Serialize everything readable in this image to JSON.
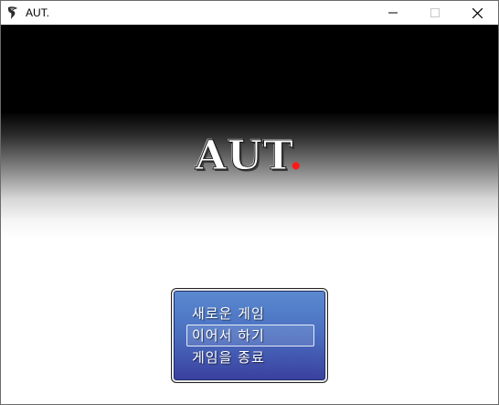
{
  "window": {
    "title": "AUT.",
    "controls": {
      "minimize_icon": "minimize-icon",
      "maximize_icon": "maximize-icon",
      "close_icon": "close-icon"
    }
  },
  "game": {
    "title_main": "AUT",
    "title_dot": ".",
    "accent_color": "#ff1a1a"
  },
  "menu": {
    "items": [
      {
        "label": "새로운 게임",
        "selected": false
      },
      {
        "label": "이어서 하기",
        "selected": true
      },
      {
        "label": "게임을 종료",
        "selected": false
      }
    ]
  }
}
